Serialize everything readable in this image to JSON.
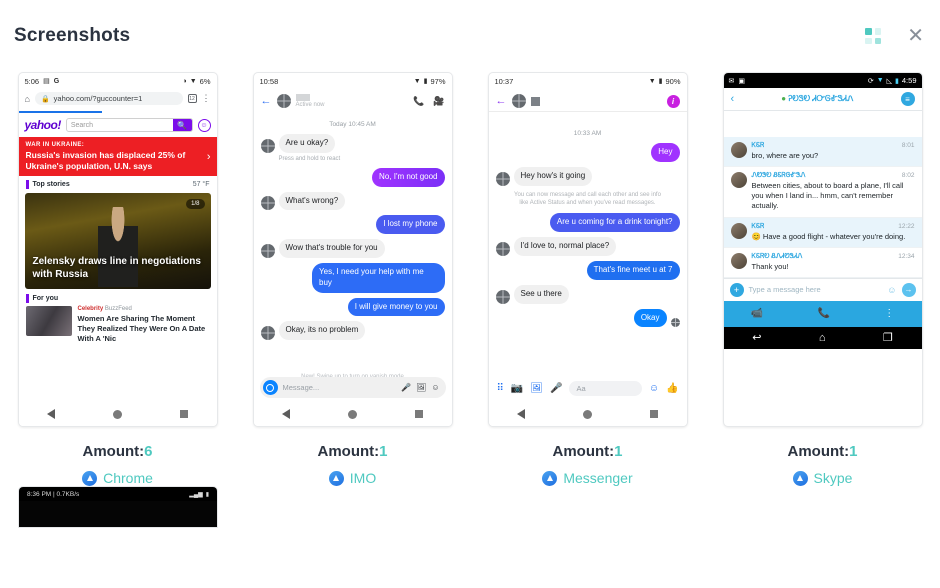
{
  "header": {
    "title": "Screenshots",
    "grid_icon": "grid-apps-icon",
    "close_icon": "✕",
    "accent_color": "#4fc9c0"
  },
  "cards": [
    {
      "amount_label": "Amount:",
      "amount_value": "6",
      "app_name": "Chrome",
      "app_icon": "app-store-icon"
    },
    {
      "amount_label": "Amount:",
      "amount_value": "1",
      "app_name": "IMO",
      "app_icon": "app-store-icon"
    },
    {
      "amount_label": "Amount:",
      "amount_value": "1",
      "app_name": "Messenger",
      "app_icon": "app-store-icon"
    },
    {
      "amount_label": "Amount:",
      "amount_value": "1",
      "app_name": "Skype",
      "app_icon": "app-store-icon"
    }
  ],
  "chrome": {
    "status_time": "5:06",
    "status_right": "6%",
    "omnibox_url": "yahoo.com/?guccounter=1",
    "tab_count": "12",
    "yahoo_logo": "yahoo!",
    "search_placeholder": "Search",
    "banner_kicker": "WAR IN UKRAINE:",
    "banner_headline": "Russia's invasion has displaced 25% of Ukraine's population, U.N. says",
    "top_stories_label": "Top stories",
    "temperature": "57 °F",
    "hero_badge": "1/8",
    "hero_headline": "Zelensky draws line in negotiations with Russia",
    "for_you_label": "For you",
    "story_category": "Celebrity",
    "story_source": "BuzzFeed",
    "story_title": "Women Are Sharing The Moment They Realized They Were On A Date With A 'Nic"
  },
  "imo": {
    "status_time": "10:58",
    "status_battery": "97%",
    "contact_status": "Active now",
    "timestamp": "Today 10:45 AM",
    "messages": [
      {
        "side": "in",
        "text": "Are u okay?"
      },
      {
        "side": "note",
        "text": "Press and hold to react"
      },
      {
        "side": "out",
        "text": "No, I'm not good"
      },
      {
        "side": "in",
        "text": "What's wrong?"
      },
      {
        "side": "out2",
        "text": "I lost my phone"
      },
      {
        "side": "in",
        "text": "Wow that's trouble for you"
      },
      {
        "side": "out3",
        "text": "Yes, I need your help with me buy"
      },
      {
        "side": "out3",
        "text": "I will give money to you"
      },
      {
        "side": "in",
        "text": "Okay, its no problem"
      }
    ],
    "vanish_note": "New! Swipe up to turn on vanish mode",
    "input_placeholder": "Message...",
    "input_icons": [
      "microphone-icon",
      "gallery-icon",
      "sticker-icon"
    ],
    "header_icons": [
      "back-arrow-icon",
      "call-icon",
      "video-call-icon"
    ]
  },
  "messenger": {
    "status_time": "10:37",
    "status_battery": "90%",
    "timestamp": "10:33 AM",
    "info_badge": "i",
    "messages": [
      {
        "side": "out",
        "text": "Hey"
      },
      {
        "side": "in",
        "text": "Hey how's it going"
      },
      {
        "side": "sys",
        "text": "You can now message and call each other and see info like Active Status and when you've read messages."
      },
      {
        "side": "outb",
        "text": "Are u coming for a drink tonight?"
      },
      {
        "side": "in",
        "text": "I'd love to, normal place?"
      },
      {
        "side": "outc",
        "text": "That's fine meet u at 7"
      },
      {
        "side": "in",
        "text": "See u there"
      },
      {
        "side": "outd",
        "text": "Okay"
      }
    ],
    "input_placeholder": "Aa",
    "toolbar_icons": [
      "apps-icon",
      "camera-icon",
      "gallery-icon",
      "microphone-icon",
      "emoji-icon",
      "thumbs-up-icon"
    ]
  },
  "skype": {
    "status_time": "4:59",
    "contact_name": "ᎮᎧᏕᎧ ᏗᏅᎶᎹᏕᏗᏁ",
    "messages": [
      {
        "name": "ᏦᏋᏒ",
        "time": "8:01",
        "text": "bro, where are you?",
        "highlight": true
      },
      {
        "name": "ᏁᏬᏕᎧ ᏰᏋᏒᎶᎹᏕᏁ",
        "time": "8:02",
        "text": "Between cities, about to board a plane, I'll call you when I land in... hmm, can't remember actually.",
        "highlight": false
      },
      {
        "name": "ᏦᏋᏒ",
        "time": "12:22",
        "text": "😊 Have a good flight - whatever you're doing.",
        "highlight": true
      },
      {
        "name": "ᏦᏋᏒᎧ ᏰᏁᏗᏬᏕᏗᏁ",
        "time": "12:34",
        "text": "Thank you!",
        "highlight": false
      }
    ],
    "input_placeholder": "Type a message here",
    "bottom_icons": [
      "video-call-icon",
      "voice-call-icon",
      "overflow-menu-icon"
    ],
    "nav_icons": [
      "back-icon",
      "home-icon",
      "recents-icon"
    ]
  },
  "partial": {
    "status_text": "8:36 PM | 0.7KB/s"
  }
}
